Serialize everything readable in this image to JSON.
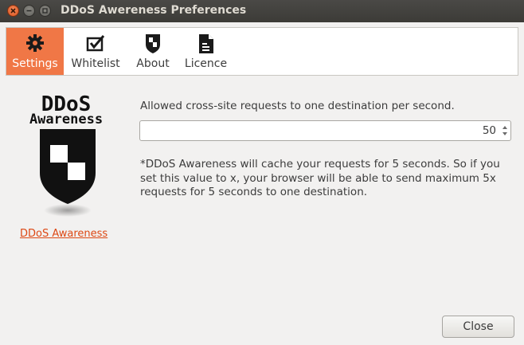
{
  "window": {
    "title": "DDoS Awereness Preferences"
  },
  "tabs": [
    {
      "label": "Settings",
      "icon": "gear-icon",
      "active": true
    },
    {
      "label": "Whitelist",
      "icon": "checkbox-icon",
      "active": false
    },
    {
      "label": "About",
      "icon": "shield-icon",
      "active": false
    },
    {
      "label": "Licence",
      "icon": "document-icon",
      "active": false
    }
  ],
  "logo": {
    "line1": "DDoS",
    "line2": "Awareness",
    "link_text": "DDoS Awareness"
  },
  "settings": {
    "label": "Allowed cross-site requests to one destination per second.",
    "value": "50",
    "description": "*DDoS Awareness will cache your requests for 5 seconds. So if you set this value to x, your browser will be able to send maximum 5x requests for 5 seconds to one destination."
  },
  "buttons": {
    "close": "Close"
  },
  "colors": {
    "accent": "#f07746",
    "link": "#dd4814",
    "titlebar": "#3c3b37"
  }
}
